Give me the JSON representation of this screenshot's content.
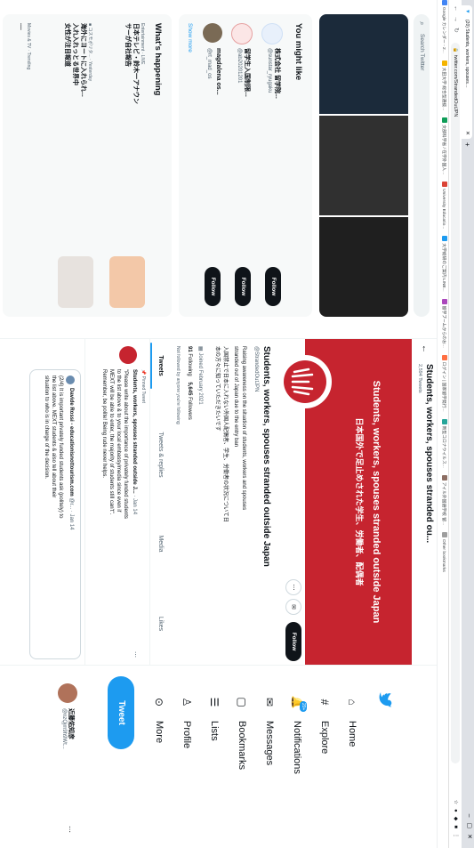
{
  "browser": {
    "tab_title": "(20) Students, workers, spouses…",
    "url": "twitter.com/StrandedOutJPN",
    "bookmarks": [
      "Google カレンダー - 2...",
      "大田大学 総合型選抜...",
      "文部科学省 / 在学外国人...",
      "University Educatio...",
      "大学総研のご案内 LINE...",
      "留学ブームからのお...",
      "ログイン | 国家留学発行...",
      "新型コロナウイルス...",
      "アイル外国語学校 留...",
      "Other bookmarks"
    ]
  },
  "nav": {
    "items": [
      {
        "label": "Home",
        "icon": "home-icon"
      },
      {
        "label": "Explore",
        "icon": "hashtag-icon"
      },
      {
        "label": "Notifications",
        "icon": "bell-icon",
        "badge": "20+"
      },
      {
        "label": "Messages",
        "icon": "envelope-icon"
      },
      {
        "label": "Bookmarks",
        "icon": "bookmark-icon"
      },
      {
        "label": "Lists",
        "icon": "list-icon"
      },
      {
        "label": "Profile",
        "icon": "person-icon"
      },
      {
        "label": "More",
        "icon": "more-circle-icon"
      }
    ],
    "tweet_button": "Tweet",
    "account": {
      "name": "近藤佑知彦",
      "handle": "@nzQjm9h9Wt..."
    }
  },
  "profile": {
    "header_title": "Students, workers, spouses stranded ou...",
    "tweet_count": "2,594 Tweets",
    "banner_line1": "Students, workers, spouses stranded outside Japan",
    "banner_line2": "日本国外で足止めされた学生、労働者、配偶者",
    "name": "Students, workers, spouses stranded outside Japan",
    "handle": "@StrandedOutJPN",
    "bio": [
      "Raising awareness on the situation of students, workers and spouses",
      "stranded out of Japan due to the entry ban",
      "入国禁止で日本に入れない外国人配偶者、学生、労働者の状況について日",
      "本の方々に知っていただきたいです"
    ],
    "joined": "Joined February 2021",
    "following_count": "91",
    "following_label": "Following",
    "followers_count": "5,645",
    "followers_label": "Followers",
    "not_followed": "Not followed by anyone you're following",
    "follow_button": "Follow",
    "tabs": [
      "Tweets",
      "Tweets & replies",
      "Media",
      "Likes"
    ]
  },
  "tweets": [
    {
      "pinned": "Pinned Tweet",
      "name": "Students, workers, spouses stranded outside J...",
      "handle": "",
      "time": "· Jan 14",
      "lines": [
        "\"Please write about the importance of privately funded students",
        "to the list above & to your local embassy/media since even if",
        "MEXT will be able to enter, the majority of students still can't\".",
        "Remember, be polite! Being rude never helps."
      ]
    },
    {
      "pinned": "",
      "name": "Davide Rossi - educationisnottourism.com",
      "handle": "@r...",
      "time": "· Jan 14",
      "lines": [
        "(2/4) It is important privately funded students ask (politely) to",
        "the list above. MEXT students & also tell about their",
        "situation to who is in charge of the decision."
      ]
    }
  ],
  "right": {
    "search_placeholder": "Search Twitter",
    "wtf_title": "You might like",
    "wtf": [
      {
        "name": "株式会社 留学院...",
        "handle": "@sunstar_ryugaku"
      },
      {
        "name": "留学生入国制限...",
        "handle": "@ab20201201"
      },
      {
        "name": "magdalena os...",
        "handle": "@rt_mad_os"
      }
    ],
    "follow_label": "Follow",
    "show_more": "Show more",
    "trends_title": "What's happening",
    "trends": [
      {
        "context": "Entertainment · LIVE",
        "lines": [
          "日本テレビ・鈴木一アナウン",
          "サーが自社報告"
        ]
      },
      {
        "context": "■ コスモポリタ... · Yesterday",
        "lines": [
          "海外にヨートに入れられ...",
          "入れ入れっとる世界中",
          "女性が注目報道"
        ]
      },
      {
        "context": "Movies & TV · Trending",
        "lines": [
          "...."
        ]
      }
    ]
  }
}
